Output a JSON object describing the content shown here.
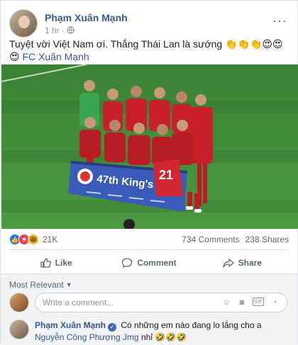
{
  "post": {
    "author": "Phạm Xuân Mạnh",
    "time": "1 hr",
    "privacy_icon": "globe-icon",
    "text": "Tuyệt vời Việt Nam ơi. Thắng Thái Lan là sướng",
    "text_emojis": "👏👏👏😍😍😍",
    "text_link": "FC Xuân Mạnh"
  },
  "photo": {
    "banner_text": "47th King's Cup",
    "banner_number": "21",
    "colors": {
      "pitch": "#3f8a3a",
      "kit": "#c8202a",
      "keeper": "#3aa651",
      "banner": "#3a5bb8"
    }
  },
  "reactions": {
    "count": "21K",
    "comments": "734 Comments",
    "shares": "238 Shares",
    "types": [
      "like",
      "love",
      "haha"
    ]
  },
  "actions": {
    "like": "Like",
    "comment": "Comment",
    "share": "Share"
  },
  "comments_section": {
    "sort_label": "Most Relevant",
    "placeholder": "Write a comment...",
    "top_comment": {
      "name": "Phạm Xuân Mạnh",
      "text": "Có những em nào đang lo lắng cho a",
      "mention": "Nguyễn Công Phượng Jmg",
      "suffix": "nhỉ",
      "emojis": "🤣🤣🤣"
    }
  },
  "colors": {
    "link": "#385898",
    "accent": "#1877f2"
  }
}
